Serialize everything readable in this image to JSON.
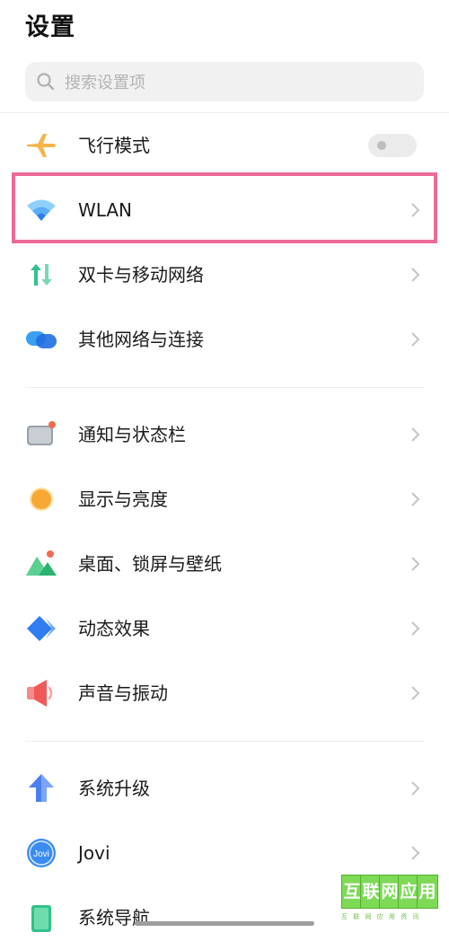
{
  "header": {
    "title": "设置"
  },
  "search": {
    "placeholder": "搜索设置项"
  },
  "section1": [
    {
      "id": "airplane",
      "label": "飞行模式",
      "icon": "airplane-icon",
      "control": "toggle",
      "toggle_on": false
    },
    {
      "id": "wlan",
      "label": "WLAN",
      "icon": "wifi-icon",
      "control": "chevron",
      "highlighted": true
    },
    {
      "id": "sim",
      "label": "双卡与移动网络",
      "icon": "dual-sim-icon",
      "control": "chevron"
    },
    {
      "id": "other-net",
      "label": "其他网络与连接",
      "icon": "connections-icon",
      "control": "chevron"
    }
  ],
  "section2": [
    {
      "id": "notifications",
      "label": "通知与状态栏",
      "icon": "notification-icon",
      "control": "chevron"
    },
    {
      "id": "display",
      "label": "显示与亮度",
      "icon": "brightness-icon",
      "control": "chevron"
    },
    {
      "id": "wallpaper",
      "label": "桌面、锁屏与壁纸",
      "icon": "wallpaper-icon",
      "control": "chevron"
    },
    {
      "id": "effects",
      "label": "动态效果",
      "icon": "animation-icon",
      "control": "chevron"
    },
    {
      "id": "sound",
      "label": "声音与振动",
      "icon": "speaker-icon",
      "control": "chevron"
    }
  ],
  "section3": [
    {
      "id": "update",
      "label": "系统升级",
      "icon": "upgrade-arrow-icon",
      "control": "chevron"
    },
    {
      "id": "jovi",
      "label": "Jovi",
      "icon": "jovi-icon",
      "icon_text": "Jovi",
      "control": "chevron"
    },
    {
      "id": "navigation",
      "label": "系统导航",
      "icon": "navigation-icon",
      "control": "chevron"
    }
  ],
  "colors": {
    "highlight_border": "#ec6a95",
    "airplane": "#f5b54a",
    "wifi": "#3d8cf0",
    "sim_green": "#2fc28a",
    "net_blue": "#3aa0f2",
    "display": "#f7a935",
    "wallpaper": "#28b46e",
    "effects": "#2f7df0",
    "sound": "#f0595a",
    "upgrade": "#4a7ff0"
  },
  "watermark": {
    "chars": [
      "互",
      "联",
      "网",
      "应",
      "用"
    ],
    "subtext": "互 联 网 应 用 资 讯"
  }
}
